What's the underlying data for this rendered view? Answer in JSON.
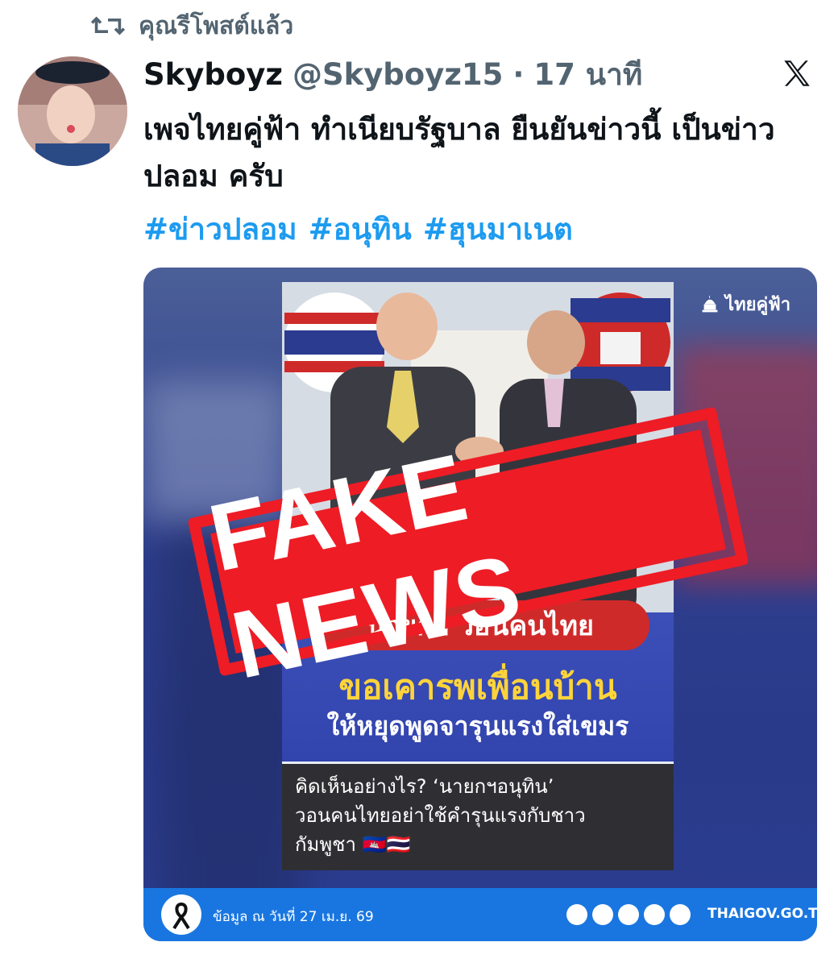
{
  "repost": {
    "text": "คุณรีโพสต์แล้ว",
    "icon": "repost-icon"
  },
  "tweet": {
    "display_name": "Skyboyz",
    "handle": "@Skyboyz15",
    "separator": "·",
    "time": "17 นาที",
    "text": "เพจไทยคู่ฟ้า ทำเนียบรัฐบาล ยืนยันข่าวนี้ เป็นข่าวปลอม ครับ",
    "hashtags": [
      "#ข่าวปลอม",
      "#อนุทิน",
      "#ฮุนมาเนต"
    ]
  },
  "media": {
    "brand": "ไทยคู่ฟ้า",
    "stamp": "FAKE NEWS",
    "headline_pill": "นายกฯ วอนคนไทย",
    "headline_main": "ขอเคารพเพื่อนบ้าน",
    "headline_sub": "ให้หยุดพูดจารุนแรงใส่เขมร",
    "caption_line1": "คิดเห็นอย่างไร? ‘นายกฯอนุทิน’",
    "caption_line2": "วอนคนไทยอย่าใช้คำรุนแรงกับชาว",
    "caption_line3": "กัมพูชา 🇰🇭🇹🇭",
    "footer_date": "ข้อมูล ณ วันที่ 27 เม.ย. 69",
    "footer_site": "THAIGOV.GO.TH"
  },
  "colors": {
    "link": "#1d9bf0",
    "muted": "#536471",
    "stamp": "#ee1c25"
  }
}
